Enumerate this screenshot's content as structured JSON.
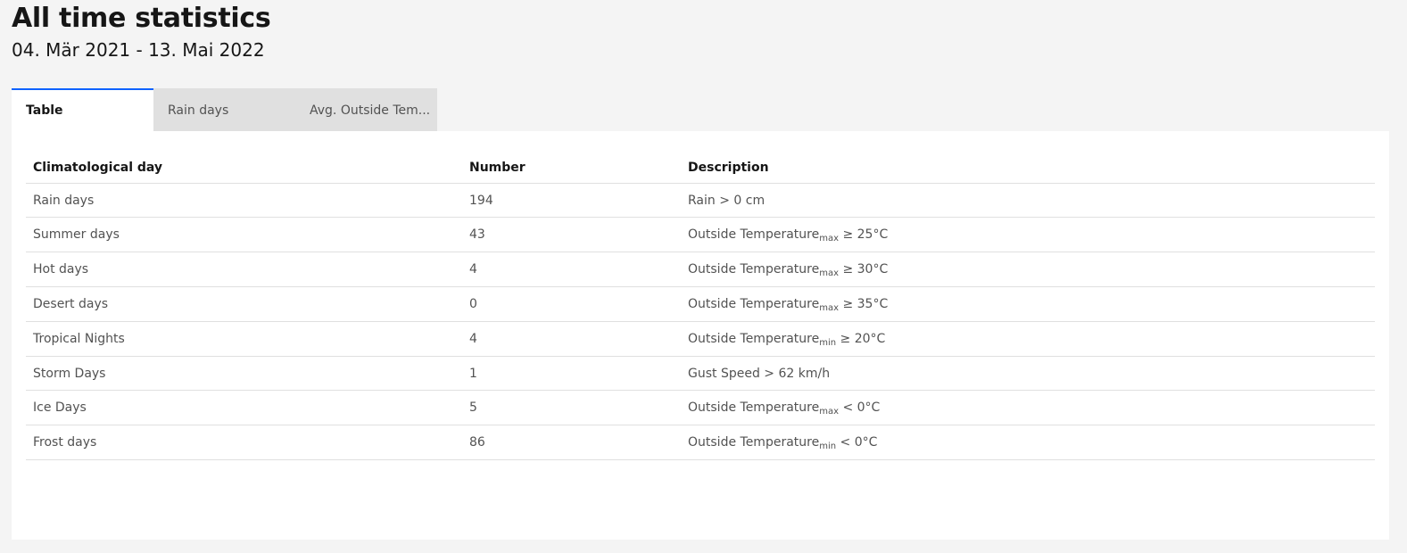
{
  "header": {
    "title": "All time statistics",
    "date_range": "04. Mär 2021 - 13. Mai 2022"
  },
  "tabs": [
    {
      "label": "Table",
      "active": true
    },
    {
      "label": "Rain days",
      "active": false
    },
    {
      "label": "Avg. Outside Tem...",
      "active": false
    }
  ],
  "table": {
    "columns": [
      "Climatological day",
      "Number",
      "Description"
    ],
    "rows": [
      {
        "day": "Rain days",
        "number": "194",
        "desc_main": "Rain > 0 cm",
        "desc_sub": "",
        "desc_rest": ""
      },
      {
        "day": "Summer days",
        "number": "43",
        "desc_main": "Outside Temperature",
        "desc_sub": "max",
        "desc_rest": " ≥ 25°C"
      },
      {
        "day": "Hot days",
        "number": "4",
        "desc_main": "Outside Temperature",
        "desc_sub": "max",
        "desc_rest": " ≥ 30°C"
      },
      {
        "day": "Desert days",
        "number": "0",
        "desc_main": "Outside Temperature",
        "desc_sub": "max",
        "desc_rest": " ≥ 35°C"
      },
      {
        "day": "Tropical Nights",
        "number": "4",
        "desc_main": "Outside Temperature",
        "desc_sub": "min",
        "desc_rest": " ≥ 20°C"
      },
      {
        "day": "Storm Days",
        "number": "1",
        "desc_main": "Gust Speed > 62 km/h",
        "desc_sub": "",
        "desc_rest": ""
      },
      {
        "day": "Ice Days",
        "number": "5",
        "desc_main": "Outside Temperature",
        "desc_sub": "max",
        "desc_rest": " < 0°C"
      },
      {
        "day": "Frost days",
        "number": "86",
        "desc_main": "Outside Temperature",
        "desc_sub": "min",
        "desc_rest": " < 0°C"
      }
    ]
  },
  "colors": {
    "background": "#f4f4f4",
    "panel": "#ffffff",
    "tab_inactive": "#e0e0e0",
    "accent": "#0f62fe"
  }
}
